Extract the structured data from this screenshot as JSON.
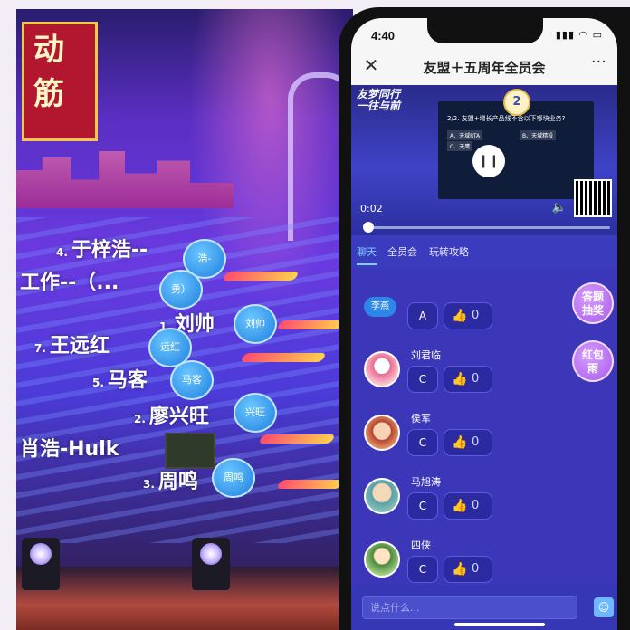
{
  "stage": {
    "sign_text": [
      "动",
      "筋"
    ],
    "rankings": [
      {
        "no": "4.",
        "name": "于梓浩--"
      },
      {
        "no": "",
        "name": "工作--（..."
      },
      {
        "no": "1.",
        "name": "刘帅"
      },
      {
        "no": "7.",
        "name": "王远红"
      },
      {
        "no": "5.",
        "name": "马客"
      },
      {
        "no": "2.",
        "name": "廖兴旺"
      },
      {
        "no": "",
        "name": "肖浩-Hulk"
      },
      {
        "no": "3.",
        "name": "周鸣"
      }
    ],
    "bubbles": [
      "浩-",
      "勇）",
      "刘帅",
      "远红",
      "马客",
      "兴旺",
      "周鸣"
    ]
  },
  "status_bar": {
    "time": "4:40",
    "icons": "▮▮▮ ◠ ▭"
  },
  "header": {
    "close": "✕",
    "title": "友盟＋五周年全员会",
    "more": "···"
  },
  "video": {
    "brand_line1": "友梦同行",
    "brand_line2": "一往与前",
    "question_number": "2",
    "question": "2/2. 友盟+增长产品线不含以下哪块业务?",
    "options": [
      "A、天域RTA",
      "B、天域精投",
      "C、天鹰"
    ],
    "pause_icon": "❙❙",
    "current_time": "0:02",
    "progress_fraction": 0.02,
    "volume_icon": "🔈"
  },
  "tabs": [
    {
      "label": "聊天",
      "active": true
    },
    {
      "label": "全员会",
      "active": false
    },
    {
      "label": "玩转攻略",
      "active": false
    }
  ],
  "messages": [
    {
      "name": "李燕",
      "answer": "A",
      "likes": "0"
    },
    {
      "name": "刘君临",
      "answer": "C",
      "likes": "0"
    },
    {
      "name": "侯军",
      "answer": "C",
      "likes": "0"
    },
    {
      "name": "马旭涛",
      "answer": "C",
      "likes": "0"
    },
    {
      "name": "四侠",
      "answer": "C",
      "likes": "0"
    }
  ],
  "floating_buttons": [
    {
      "line1": "答题",
      "line2": "抽奖"
    },
    {
      "line1": "红包",
      "line2": "雨"
    }
  ],
  "input": {
    "placeholder": "说点什么..."
  },
  "colors": {
    "chat_bg": "#3b37b8",
    "accent": "#7fd0ff",
    "float_btn": "#a95bea"
  }
}
